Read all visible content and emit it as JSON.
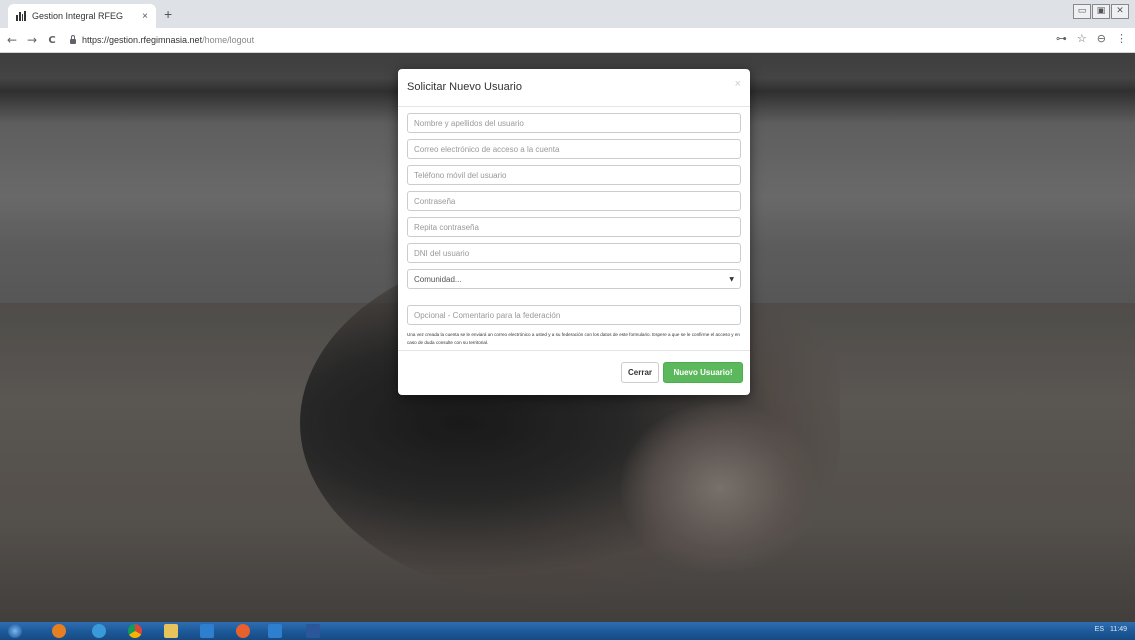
{
  "browser": {
    "tab_title": "Gestion Integral RFEG",
    "tab_close": "×",
    "new_tab": "+",
    "url_host": "https://gestion.rfegimnasia.net",
    "url_path": "/home/logout",
    "nav": {
      "back": "←",
      "forward": "→",
      "reload": "C"
    },
    "window_controls": [
      "▭",
      "▣",
      "✕"
    ],
    "tools": [
      "⊶",
      "☆",
      "⊖",
      "⋮"
    ]
  },
  "modal": {
    "title": "Solicitar Nuevo Usuario",
    "close": "×",
    "fields": {
      "name": "Nombre y apellidos del usuario",
      "email": "Correo electrónico de acceso a la cuenta",
      "phone": "Teléfono móvil del usuario",
      "password": "Contraseña",
      "password_repeat": "Repita contraseña",
      "dni": "DNI del usuario",
      "community": "Comunidad...",
      "comment": "Opcional - Comentario para la federación"
    },
    "help_text": "Una vez creada la cuenta se le enviará un correo electrónico a usted y a su federación con los datos de este formulario. Espere a que se le confirme el acceso y en caso de duda consulte con su territorial.",
    "buttons": {
      "close": "Cerrar",
      "submit": "Nuevo Usuario!"
    },
    "colors": {
      "primary": "#5cb85c"
    }
  },
  "taskbar": {
    "tray_lang": "ES",
    "tray_time": "11:49"
  }
}
